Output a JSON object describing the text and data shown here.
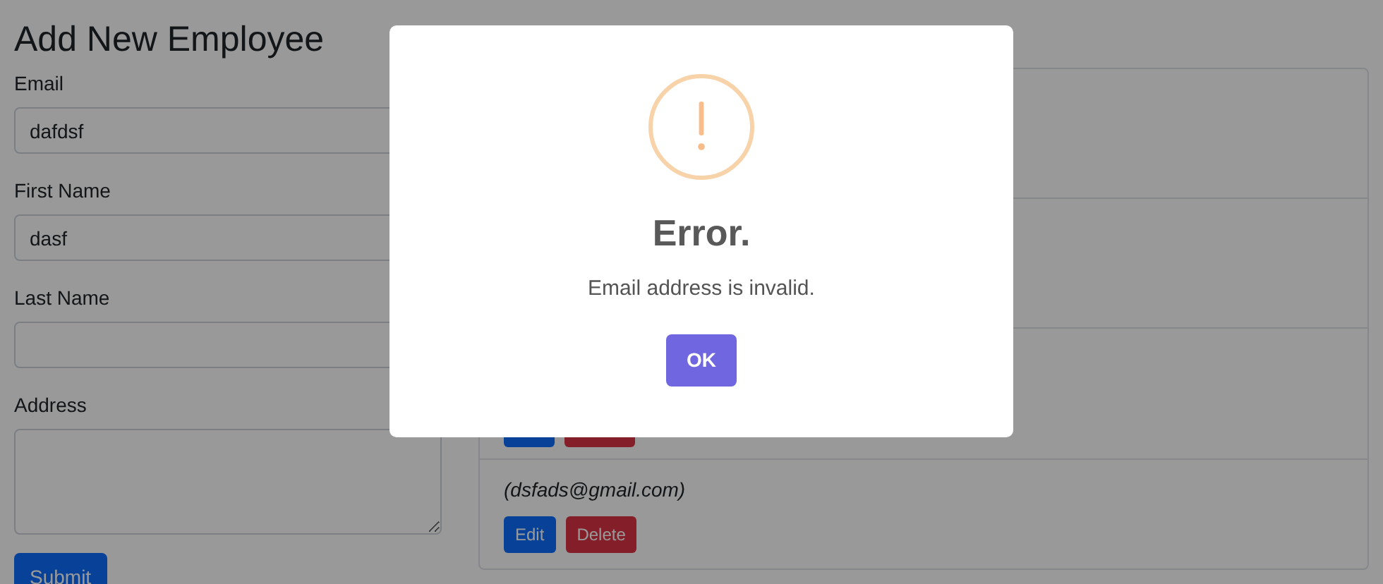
{
  "page": {
    "title": "Add New Employee"
  },
  "form": {
    "fields": [
      {
        "kind": "input",
        "label": "Email",
        "value": "dafdsf"
      },
      {
        "kind": "input",
        "label": "First Name",
        "value": "dasf"
      },
      {
        "kind": "input",
        "label": "Last Name"
      },
      {
        "kind": "textarea",
        "label": "Address"
      }
    ],
    "submit": "Submit"
  },
  "employees": [
    {
      "kind": "covered"
    },
    {
      "kind": "covered"
    },
    {
      "kind": "covered-buttons"
    },
    {
      "kind": "entry",
      "email": "(dsfads@gmail.com)",
      "edit": "Edit",
      "delete": "Delete"
    }
  ],
  "dialog": {
    "title": "Error.",
    "message": "Email address is invalid.",
    "confirm": "OK"
  }
}
